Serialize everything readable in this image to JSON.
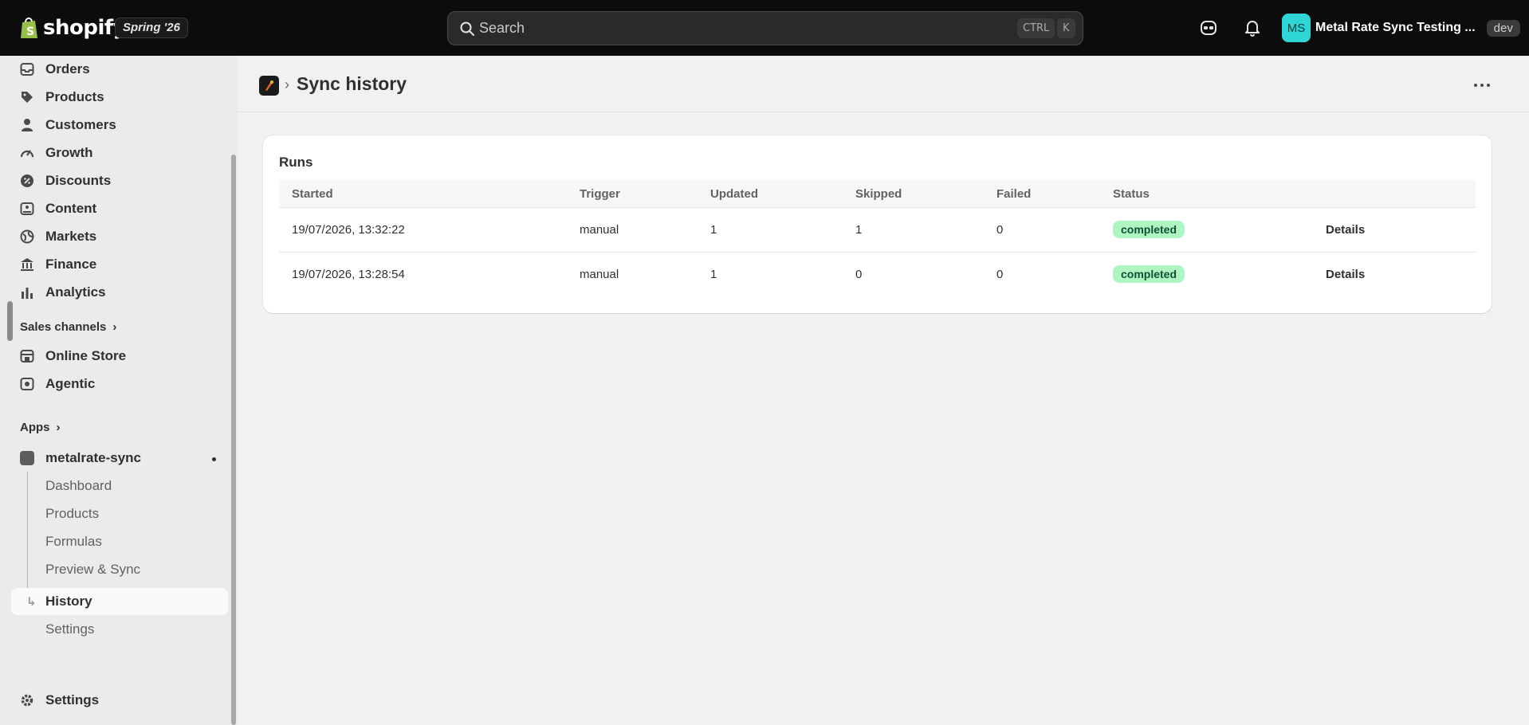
{
  "topbar": {
    "logo_text": "shopify",
    "release_badge": "Spring '26",
    "search_placeholder": "Search",
    "kbd_ctrl": "CTRL",
    "kbd_k": "K",
    "avatar_initials": "MS",
    "store_name": "Metal Rate Sync Testing ...",
    "dev_badge": "dev"
  },
  "sidebar": {
    "items": [
      {
        "label": "Orders",
        "icon": "inbox-icon"
      },
      {
        "label": "Products",
        "icon": "tag-icon"
      },
      {
        "label": "Customers",
        "icon": "person-icon"
      },
      {
        "label": "Growth",
        "icon": "gauge-icon"
      },
      {
        "label": "Discounts",
        "icon": "discount-icon"
      },
      {
        "label": "Content",
        "icon": "image-icon"
      },
      {
        "label": "Markets",
        "icon": "globe-icon"
      },
      {
        "label": "Finance",
        "icon": "bank-icon"
      },
      {
        "label": "Analytics",
        "icon": "bar-chart-icon"
      }
    ],
    "sales_channels_label": "Sales channels",
    "channels": [
      {
        "label": "Online Store",
        "icon": "store-icon"
      },
      {
        "label": "Agentic",
        "icon": "robot-icon"
      }
    ],
    "apps_label": "Apps",
    "app_name": "metalrate-sync",
    "app_subitems": [
      "Dashboard",
      "Products",
      "Formulas",
      "Preview & Sync",
      "History",
      "Settings"
    ],
    "active_subitem": "History",
    "settings_label": "Settings"
  },
  "page": {
    "title": "Sync history"
  },
  "runs": {
    "card_title": "Runs",
    "columns": [
      "Started",
      "Trigger",
      "Updated",
      "Skipped",
      "Failed",
      "Status"
    ],
    "rows": [
      {
        "started": "19/07/2026, 13:32:22",
        "trigger": "manual",
        "updated": "1",
        "skipped": "1",
        "failed": "0",
        "status": "completed",
        "action": "Details"
      },
      {
        "started": "19/07/2026, 13:28:54",
        "trigger": "manual",
        "updated": "1",
        "skipped": "0",
        "failed": "0",
        "status": "completed",
        "action": "Details"
      }
    ]
  },
  "colors": {
    "topbar_bg": "#0c0c0c",
    "status_badge_bg": "#aff5c2",
    "status_badge_text": "#0c5132",
    "avatar_bg": "#2ed6d6"
  }
}
